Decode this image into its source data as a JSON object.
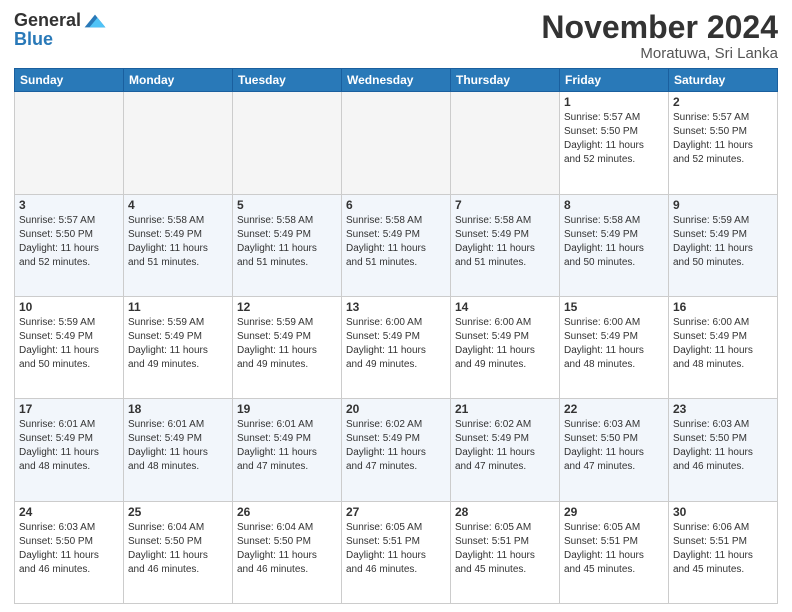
{
  "header": {
    "logo_general": "General",
    "logo_blue": "Blue",
    "month_title": "November 2024",
    "location": "Moratuwa, Sri Lanka"
  },
  "weekdays": [
    "Sunday",
    "Monday",
    "Tuesday",
    "Wednesday",
    "Thursday",
    "Friday",
    "Saturday"
  ],
  "weeks": [
    [
      {
        "day": "",
        "info": ""
      },
      {
        "day": "",
        "info": ""
      },
      {
        "day": "",
        "info": ""
      },
      {
        "day": "",
        "info": ""
      },
      {
        "day": "",
        "info": ""
      },
      {
        "day": "1",
        "info": "Sunrise: 5:57 AM\nSunset: 5:50 PM\nDaylight: 11 hours\nand 52 minutes."
      },
      {
        "day": "2",
        "info": "Sunrise: 5:57 AM\nSunset: 5:50 PM\nDaylight: 11 hours\nand 52 minutes."
      }
    ],
    [
      {
        "day": "3",
        "info": "Sunrise: 5:57 AM\nSunset: 5:50 PM\nDaylight: 11 hours\nand 52 minutes."
      },
      {
        "day": "4",
        "info": "Sunrise: 5:58 AM\nSunset: 5:49 PM\nDaylight: 11 hours\nand 51 minutes."
      },
      {
        "day": "5",
        "info": "Sunrise: 5:58 AM\nSunset: 5:49 PM\nDaylight: 11 hours\nand 51 minutes."
      },
      {
        "day": "6",
        "info": "Sunrise: 5:58 AM\nSunset: 5:49 PM\nDaylight: 11 hours\nand 51 minutes."
      },
      {
        "day": "7",
        "info": "Sunrise: 5:58 AM\nSunset: 5:49 PM\nDaylight: 11 hours\nand 51 minutes."
      },
      {
        "day": "8",
        "info": "Sunrise: 5:58 AM\nSunset: 5:49 PM\nDaylight: 11 hours\nand 50 minutes."
      },
      {
        "day": "9",
        "info": "Sunrise: 5:59 AM\nSunset: 5:49 PM\nDaylight: 11 hours\nand 50 minutes."
      }
    ],
    [
      {
        "day": "10",
        "info": "Sunrise: 5:59 AM\nSunset: 5:49 PM\nDaylight: 11 hours\nand 50 minutes."
      },
      {
        "day": "11",
        "info": "Sunrise: 5:59 AM\nSunset: 5:49 PM\nDaylight: 11 hours\nand 49 minutes."
      },
      {
        "day": "12",
        "info": "Sunrise: 5:59 AM\nSunset: 5:49 PM\nDaylight: 11 hours\nand 49 minutes."
      },
      {
        "day": "13",
        "info": "Sunrise: 6:00 AM\nSunset: 5:49 PM\nDaylight: 11 hours\nand 49 minutes."
      },
      {
        "day": "14",
        "info": "Sunrise: 6:00 AM\nSunset: 5:49 PM\nDaylight: 11 hours\nand 49 minutes."
      },
      {
        "day": "15",
        "info": "Sunrise: 6:00 AM\nSunset: 5:49 PM\nDaylight: 11 hours\nand 48 minutes."
      },
      {
        "day": "16",
        "info": "Sunrise: 6:00 AM\nSunset: 5:49 PM\nDaylight: 11 hours\nand 48 minutes."
      }
    ],
    [
      {
        "day": "17",
        "info": "Sunrise: 6:01 AM\nSunset: 5:49 PM\nDaylight: 11 hours\nand 48 minutes."
      },
      {
        "day": "18",
        "info": "Sunrise: 6:01 AM\nSunset: 5:49 PM\nDaylight: 11 hours\nand 48 minutes."
      },
      {
        "day": "19",
        "info": "Sunrise: 6:01 AM\nSunset: 5:49 PM\nDaylight: 11 hours\nand 47 minutes."
      },
      {
        "day": "20",
        "info": "Sunrise: 6:02 AM\nSunset: 5:49 PM\nDaylight: 11 hours\nand 47 minutes."
      },
      {
        "day": "21",
        "info": "Sunrise: 6:02 AM\nSunset: 5:49 PM\nDaylight: 11 hours\nand 47 minutes."
      },
      {
        "day": "22",
        "info": "Sunrise: 6:03 AM\nSunset: 5:50 PM\nDaylight: 11 hours\nand 47 minutes."
      },
      {
        "day": "23",
        "info": "Sunrise: 6:03 AM\nSunset: 5:50 PM\nDaylight: 11 hours\nand 46 minutes."
      }
    ],
    [
      {
        "day": "24",
        "info": "Sunrise: 6:03 AM\nSunset: 5:50 PM\nDaylight: 11 hours\nand 46 minutes."
      },
      {
        "day": "25",
        "info": "Sunrise: 6:04 AM\nSunset: 5:50 PM\nDaylight: 11 hours\nand 46 minutes."
      },
      {
        "day": "26",
        "info": "Sunrise: 6:04 AM\nSunset: 5:50 PM\nDaylight: 11 hours\nand 46 minutes."
      },
      {
        "day": "27",
        "info": "Sunrise: 6:05 AM\nSunset: 5:51 PM\nDaylight: 11 hours\nand 46 minutes."
      },
      {
        "day": "28",
        "info": "Sunrise: 6:05 AM\nSunset: 5:51 PM\nDaylight: 11 hours\nand 45 minutes."
      },
      {
        "day": "29",
        "info": "Sunrise: 6:05 AM\nSunset: 5:51 PM\nDaylight: 11 hours\nand 45 minutes."
      },
      {
        "day": "30",
        "info": "Sunrise: 6:06 AM\nSunset: 5:51 PM\nDaylight: 11 hours\nand 45 minutes."
      }
    ]
  ]
}
